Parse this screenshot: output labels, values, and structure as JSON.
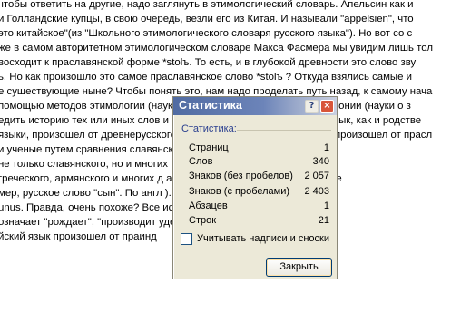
{
  "document": {
    "lines": [
      "чтобы ответить на другие, надо заглянуть в этимологический словарь.  Апельсин  как и",
      "и Голландские купцы, в свою очередь, везли его из Китая. И называли \"appelsien\", что",
      "это китайское\"(из \"Школьного этимологического словаря русского языка\"). Но вот со с",
      "же в самом авторитетном этимологическом словаре Максa Фасмера мы увидим лишь тол",
      "восходит к праславянской форме  *stolъ. То есть, и в глубокой древности это слово зву",
      "ь. Но как произошло это самое праславянское слово *stolъ ? Откуда взялись самые и",
      "е существующие ныне? Чтобы понять это, нам надо проделать путь назад, к самому нача",
      "помощью методов этимологии (науки о происхождении слов) и глоттогонии (науки о  з",
      "едить историю тех или иных слов и языков. Например, наш русский язык, как и родстве",
      "языки, произошел от древнерусского (или            ) , который в свою очередь произошел от прасл",
      "и ученые путем сравнения славянских,                                   , как и где выделился из и",
      "не только славянского, но и многих                          , хеттского, французского, ит",
      "греческого, армянского и многих д                           а позволило установить индоевропе",
      "мер, русское слово \"сын\". По англ                              ). по немецки - Sc",
      "unus. Правда, очень похоже? Все                            источнику: древнеин",
      "означает \"рождает\", \"производит                                  удет еще дальше в глу",
      "йский язык произошел от праинд"
    ]
  },
  "dialog": {
    "title": "Статистика",
    "help_glyph": "?",
    "close_glyph": "×",
    "section_label": "Статистика:",
    "rows": [
      {
        "label": "Страниц",
        "value": "1"
      },
      {
        "label": "Слов",
        "value": "340"
      },
      {
        "label": "Знаков (без пробелов)",
        "value": "2 057"
      },
      {
        "label": "Знаков (с пробелами)",
        "value": "2 403"
      },
      {
        "label": "Абзацев",
        "value": "1"
      },
      {
        "label": "Строк",
        "value": "21"
      }
    ],
    "checkbox_label": "Учитывать надписи и сноски",
    "checkbox_checked": false,
    "close_button": "Закрыть"
  }
}
